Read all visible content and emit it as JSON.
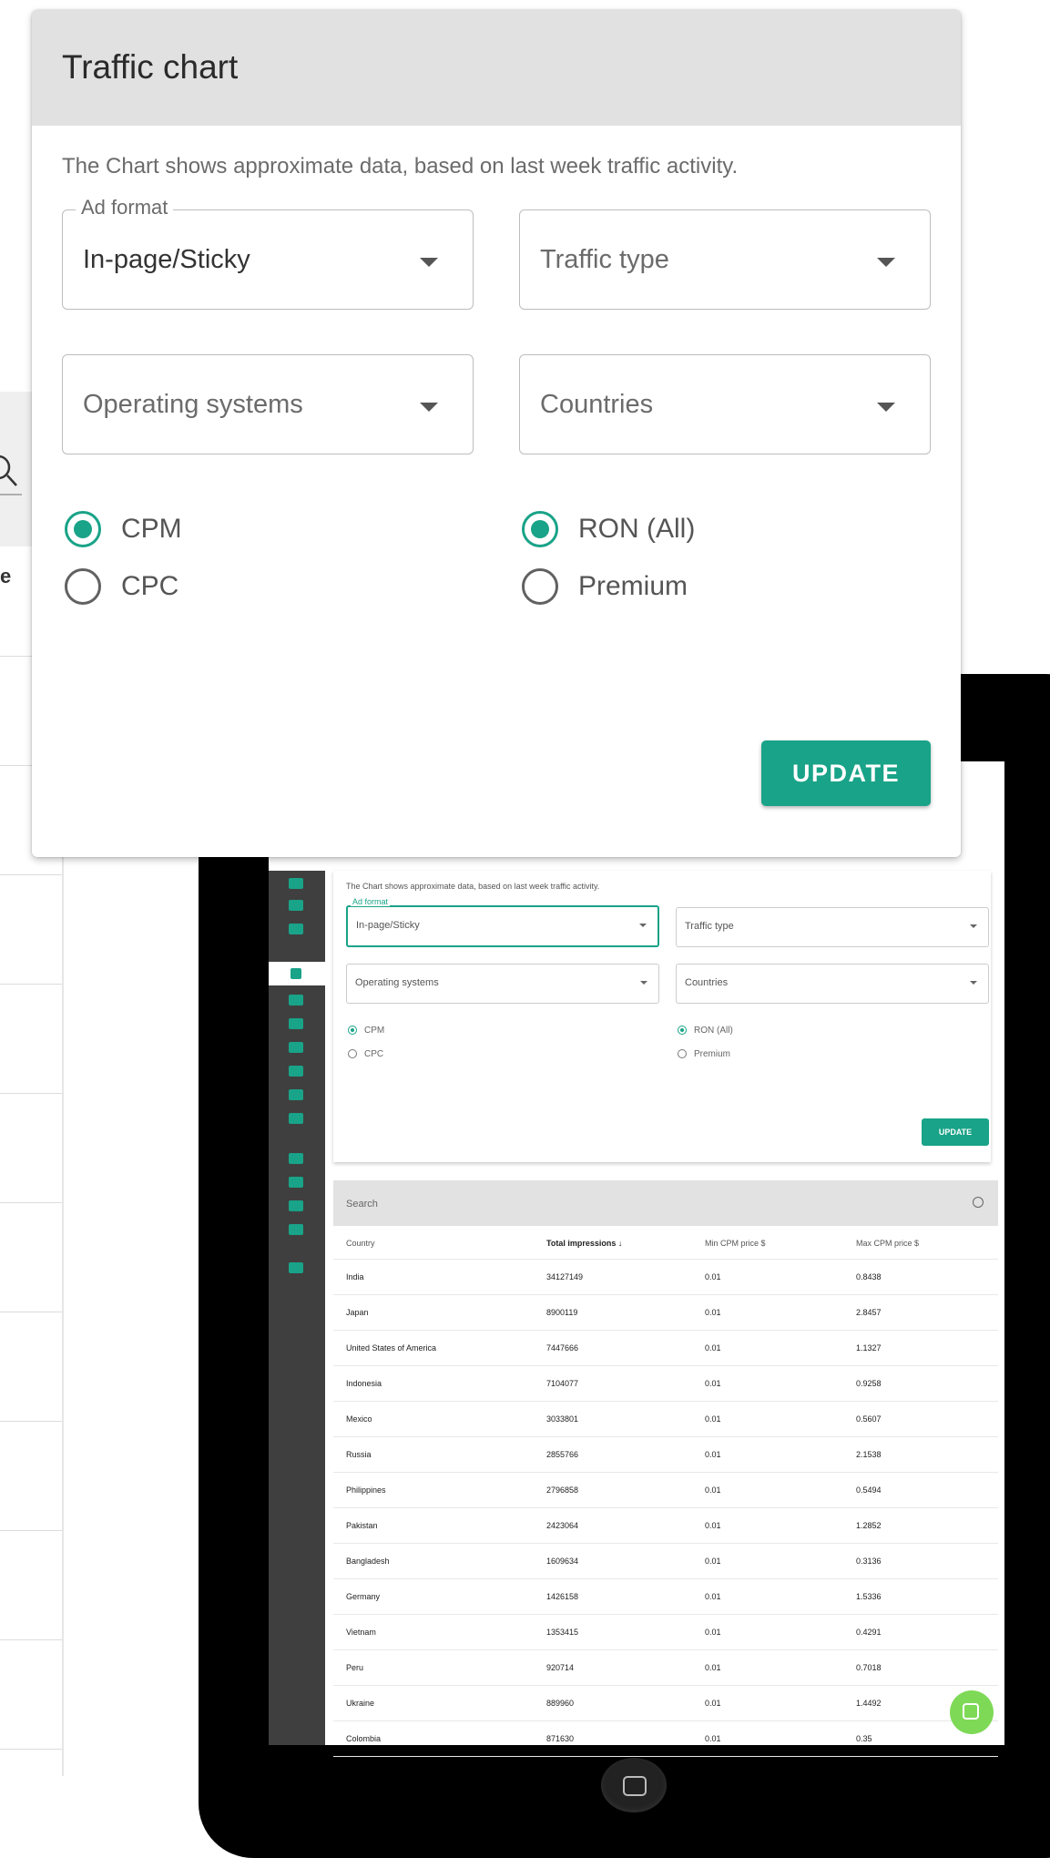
{
  "card": {
    "title": "Traffic chart",
    "description": "The Chart shows approximate data, based on last week traffic activity.",
    "ad_format": {
      "label": "Ad format",
      "value": "In-page/Sticky"
    },
    "traffic_type": {
      "placeholder": "Traffic type"
    },
    "operating_systems": {
      "placeholder": "Operating systems"
    },
    "countries": {
      "placeholder": "Countries"
    },
    "pricing": [
      {
        "label": "CPM",
        "selected": true
      },
      {
        "label": "CPC",
        "selected": false
      }
    ],
    "inventory": [
      {
        "label": "RON (All)",
        "selected": true
      },
      {
        "label": "Premium",
        "selected": false
      }
    ],
    "update_label": "UPDATE"
  },
  "background": {
    "partial_letter": "e"
  },
  "tablet": {
    "description": "The Chart shows approximate data, based on last week traffic activity.",
    "ad_format_label": "Ad format",
    "ad_format_value": "In-page/Sticky",
    "traffic_type": "Traffic type",
    "operating_systems": "Operating systems",
    "countries": "Countries",
    "radios": {
      "cpm": "CPM",
      "cpc": "CPC",
      "ron": "RON (All)",
      "premium": "Premium"
    },
    "update_label": "UPDATE",
    "search_placeholder": "Search",
    "table": {
      "columns": [
        "Country",
        "Total impressions ↓",
        "Min CPM price $",
        "Max CPM price $"
      ],
      "rows": [
        [
          "India",
          "34127149",
          "0.01",
          "0.8438"
        ],
        [
          "Japan",
          "8900119",
          "0.01",
          "2.8457"
        ],
        [
          "United States of America",
          "7447666",
          "0.01",
          "1.1327"
        ],
        [
          "Indonesia",
          "7104077",
          "0.01",
          "0.9258"
        ],
        [
          "Mexico",
          "3033801",
          "0.01",
          "0.5607"
        ],
        [
          "Russia",
          "2855766",
          "0.01",
          "2.1538"
        ],
        [
          "Philippines",
          "2796858",
          "0.01",
          "0.5494"
        ],
        [
          "Pakistan",
          "2423064",
          "0.01",
          "1.2852"
        ],
        [
          "Bangladesh",
          "1609634",
          "0.01",
          "0.3136"
        ],
        [
          "Germany",
          "1426158",
          "0.01",
          "1.5336"
        ],
        [
          "Vietnam",
          "1353415",
          "0.01",
          "0.4291"
        ],
        [
          "Peru",
          "920714",
          "0.01",
          "0.7018"
        ],
        [
          "Ukraine",
          "889960",
          "0.01",
          "1.4492"
        ],
        [
          "Colombia",
          "871630",
          "0.01",
          "0.35"
        ]
      ]
    }
  },
  "colors": {
    "accent": "#19a388",
    "header_bg": "#e1e1e1",
    "chat": "#7ed957"
  }
}
